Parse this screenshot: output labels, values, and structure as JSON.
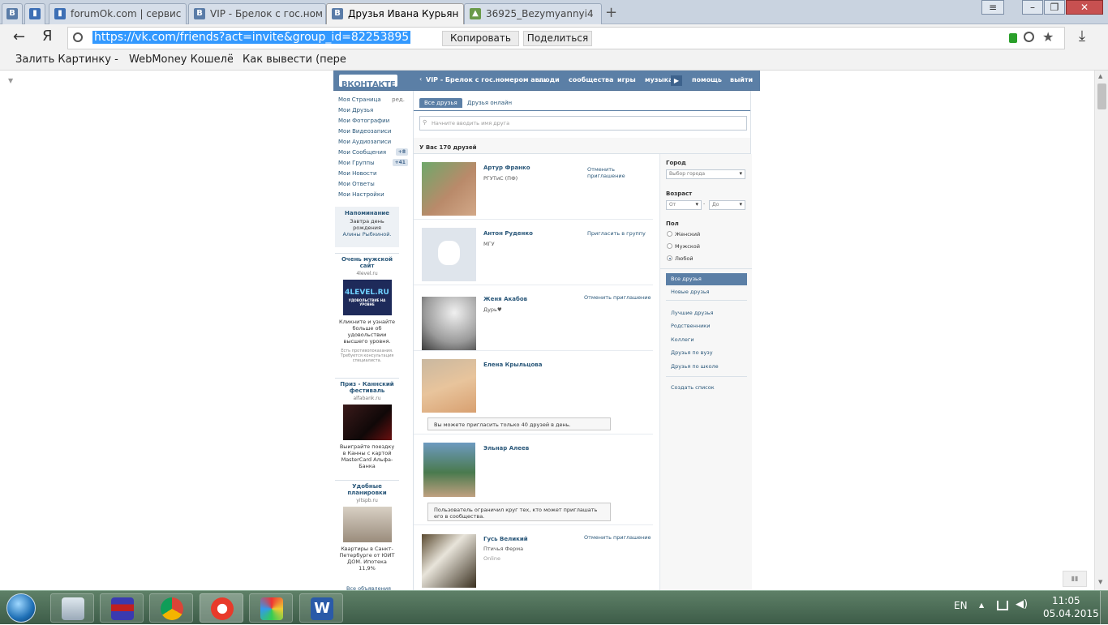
{
  "tabs": [
    {
      "label": "",
      "favicon": "В"
    },
    {
      "label": "",
      "favicon": "book-icon"
    },
    {
      "label": "forumOk.com | сервис",
      "favicon": "book-icon"
    },
    {
      "label": "VIP - Брелок с гос.ном",
      "favicon": "В"
    },
    {
      "label": "Друзья Ивана Курьян",
      "favicon": "В",
      "active": true
    },
    {
      "label": "36925_Bezymyannyi4",
      "favicon": "image-icon"
    }
  ],
  "addressbar": {
    "logo": "Я",
    "url": "https://vk.com/friends?act=invite&group_id=82253895",
    "copy_label": "Копировать",
    "share_label": "Поделиться"
  },
  "bookmarks": [
    "Залить Картинку - З",
    "WebMoney Кошелё",
    "Как вывести (переве"
  ],
  "vk": {
    "logo": "ВКОНТАКТЕ",
    "breadcrumb": "VIP - Брелок с гос.номером ав...",
    "nav": [
      "люди",
      "сообщества",
      "игры",
      "музыка",
      "помощь",
      "выйти"
    ],
    "left_menu": [
      {
        "label": "Моя Страница",
        "extra": "ред."
      },
      {
        "label": "Мои Друзья"
      },
      {
        "label": "Мои Фотографии"
      },
      {
        "label": "Мои Видеозаписи"
      },
      {
        "label": "Мои Аудиозаписи"
      },
      {
        "label": "Мои Сообщения",
        "count": "+8"
      },
      {
        "label": "Мои Группы",
        "count": "+41"
      },
      {
        "label": "Мои Новости"
      },
      {
        "label": "Мои Ответы"
      },
      {
        "label": "Мои Настройки"
      }
    ],
    "reminder": {
      "title": "Напоминание",
      "text": "Завтра день рождения",
      "name": "Алины Рыбкиной."
    },
    "ads": [
      {
        "title": "Очень мужской сайт",
        "domain": "4level.ru",
        "img": "4LEVEL.RU",
        "img_sub": "УДОВОЛЬСТВИЕ НА УРОВНЕ",
        "text": "Кликните и узнайте больше об удовольствии высшего уровня.",
        "disclaimer": "Есть противопоказания. Требуется консультация специалиста."
      },
      {
        "title": "Приз - Каннский фестиваль",
        "domain": "alfabank.ru",
        "text": "Выиграйте поездку в Канны с картой MasterCard Альфа-Банка"
      },
      {
        "title": "Удобные планировки",
        "domain": "yitspb.ru",
        "text": "Квартиры в Санкт-Петербурге от ЮИТ ДОМ. Ипотека 11,9%"
      }
    ],
    "all_ads": "Все объявления",
    "tabs": [
      "Все друзья",
      "Друзья онлайн"
    ],
    "search_placeholder": "Начните вводить имя друга",
    "friends_count": "У Вас 170 друзей",
    "friends": [
      {
        "name": "Артур Франко",
        "sub": "РГУТиС (ПФ)",
        "action": "Отменить приглашение"
      },
      {
        "name": "Антон Руденко",
        "sub": "МГУ",
        "action": "Пригласить в группу"
      },
      {
        "name": "Женя Акабов",
        "sub": "Дурь♥",
        "action": "Отменить приглашение"
      },
      {
        "name": "Елена Крыльцова",
        "sub": "",
        "action": "",
        "note": "Вы можете пригласить только 40 друзей в день."
      },
      {
        "name": "Эльнар Алеев",
        "sub": "",
        "action": "",
        "note": "Пользователь ограничил круг тех, кто может приглашать его в сообщества."
      },
      {
        "name": "Гусь Великий",
        "sub": "Птичья Ферма",
        "status": "Online",
        "action": "Отменить приглашение"
      }
    ],
    "filters": {
      "city_label": "Город",
      "city_placeholder": "Выбор города",
      "age_label": "Возраст",
      "age_from": "От",
      "age_to": "До",
      "gender_label": "Пол",
      "genders": [
        "Женский",
        "Мужской",
        "Любой"
      ],
      "selected_gender": "Любой",
      "lists": [
        "Все друзья",
        "Новые друзья",
        "Лучшие друзья",
        "Родственники",
        "Коллеги",
        "Друзья по вузу",
        "Друзья по школе",
        "Создать список"
      ]
    }
  },
  "taskbar": {
    "lang": "EN",
    "time": "11:05",
    "date": "05.04.2015"
  }
}
